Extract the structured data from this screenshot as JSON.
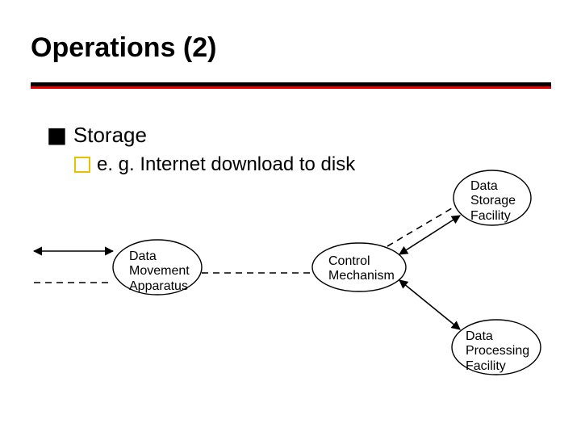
{
  "title": "Operations (2)",
  "bullets": {
    "level1": "Storage",
    "level2": "e. g. Internet download to disk"
  },
  "nodes": {
    "data_movement": "Data\nMovement\nApparatus",
    "control_mechanism": "Control\nMechanism",
    "data_storage": "Data\nStorage\nFacility",
    "data_processing": "Data\nProcessing\nFacility"
  },
  "icons": {
    "filled_square": "◼",
    "hollow_square": "□"
  }
}
